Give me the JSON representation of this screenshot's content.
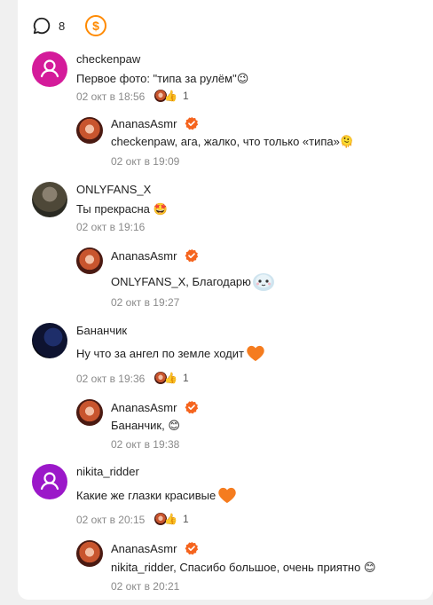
{
  "header": {
    "comment_count": "8"
  },
  "comments": [
    {
      "author": "checkenpaw",
      "text": "Первое фото: \"типа за рулём\"",
      "emoji": "😉",
      "date": "02 окт в 18:56",
      "likes": "1",
      "reply": {
        "author": "AnanasAsmr",
        "text": "checkenpaw, ага, жалко, что только «типа»",
        "emoji": "🫠",
        "date": "02 окт в 19:09"
      }
    },
    {
      "author": "ONLYFANS_X",
      "text": "Ты прекрасна",
      "emoji": "🤩",
      "date": "02 окт в 19:16",
      "reply": {
        "author": "AnanasAsmr",
        "text": "ONLYFANS_X, Благодарю",
        "date": "02 окт в 19:27"
      }
    },
    {
      "author": "Бананчик",
      "text": "Ну что за ангел по земле ходит",
      "date": "02 окт в 19:36",
      "likes": "1",
      "reply": {
        "author": "AnanasAsmr",
        "text": "Бананчик,",
        "emoji": "😊",
        "date": "02 окт в 19:38"
      }
    },
    {
      "author": "nikita_ridder",
      "text": "Какие же глазки красивые",
      "date": "02 окт в 20:15",
      "likes": "1",
      "reply": {
        "author": "AnanasAsmr",
        "text": "nikita_ridder, Спасибо большое, очень приятно",
        "emoji": "😊",
        "date": "02 окт в 20:21"
      }
    }
  ],
  "colors": {
    "accent": "#ff8a00",
    "verified": "#f5641e",
    "avatar_magenta": "#d41b9a",
    "avatar_purple": "#9b18c9"
  }
}
